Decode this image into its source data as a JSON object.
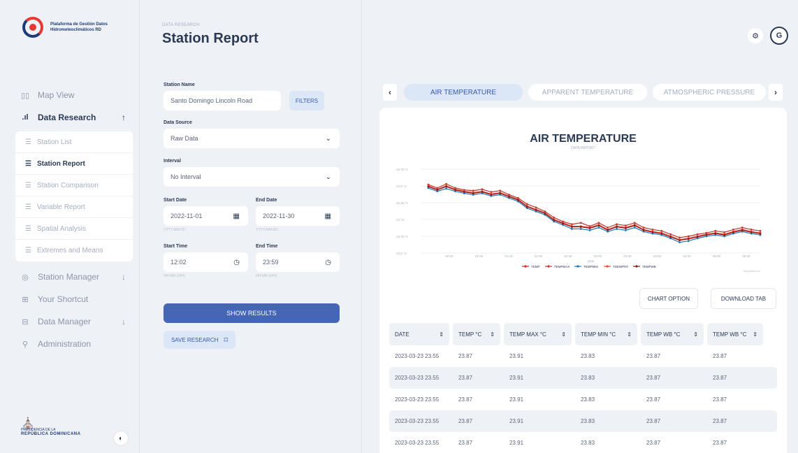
{
  "brand": {
    "line1": "Plataforma de Gestión Datos",
    "line2": "Hidrometeoclimáticos RD",
    "footer_line1": "PRESIDENCIA DE LA",
    "footer_line2": "REPÚBLICA DOMINICANA"
  },
  "sidebar": {
    "items": [
      {
        "label": "Map View",
        "icon": "map-icon"
      },
      {
        "label": "Data Research",
        "icon": "bar-chart-icon",
        "arrow": "↑"
      },
      {
        "label": "Station Manager",
        "icon": "location-pin-icon",
        "arrow": "↓"
      },
      {
        "label": "Your Shortcut",
        "icon": "grid-icon"
      },
      {
        "label": "Data Manager",
        "icon": "database-icon",
        "arrow": "↓"
      },
      {
        "label": "Administration",
        "icon": "wrench-icon"
      }
    ],
    "subitems": [
      {
        "label": "Station List"
      },
      {
        "label": "Station Report"
      },
      {
        "label": "Station Comparison"
      },
      {
        "label": "Variable Report"
      },
      {
        "label": "Spatial Analysis"
      },
      {
        "label": "Extremes and Means"
      }
    ]
  },
  "header": {
    "breadcrumb": "DATA RESEARCH",
    "title": "Station Report"
  },
  "form": {
    "station_name_label": "Station Name",
    "station_name_value": "Santo Domingo Lincoln Road",
    "filters_label": "FILTERS",
    "data_source_label": "Data Source",
    "data_source_value": "Raw Data",
    "interval_label": "Interval",
    "interval_value": "No Interval",
    "start_date_label": "Start Date",
    "start_date_value": "2022-11-01",
    "start_date_hint": "YYYY-MM-DD",
    "end_date_label": "End Date",
    "end_date_value": "2022-11-30",
    "end_date_hint": "YYYY-MM-DD",
    "start_time_label": "Start Time",
    "start_time_value": "12:02",
    "start_time_hint": "HH:MM (24H)",
    "end_time_label": "End Time",
    "end_time_value": "23:59",
    "end_time_hint": "HH:MM (24H)",
    "show_results_label": "SHOW RESULTS",
    "save_research_label": "SAVE RESEARCH"
  },
  "tabs": [
    {
      "label": "AIR TEMPERATURE",
      "active": true
    },
    {
      "label": "APPARENT TEMPERATURE",
      "active": false
    },
    {
      "label": "ATMOSPHERIC PRESSURE",
      "active": false
    }
  ],
  "chart_option_label": "CHART OPTION",
  "download_label": "DOWNLOAD TAB",
  "chart_data": {
    "type": "line",
    "title": "AIR TEMPERATURE",
    "subtitle": "DATA REPORT",
    "xlabel": "Date",
    "ylabel": "",
    "yticks": [
      "24.75 °C",
      "24.5 °C",
      "24.25 °C",
      "24 °C",
      "23.75 °C",
      "23.5 °C"
    ],
    "ylim": [
      23.5,
      24.75
    ],
    "xticks": [
      "00:30",
      "01:00",
      "01:30",
      "02:00",
      "02:30",
      "03:00",
      "03:30",
      "04:00",
      "04:30",
      "05:00",
      "05:30"
    ],
    "credit": "Highcharts.com",
    "series": [
      {
        "name": "TEMP",
        "color": "#d62728",
        "values": [
          24.5,
          24.45,
          24.5,
          24.45,
          24.42,
          24.4,
          24.42,
          24.38,
          24.4,
          24.35,
          24.3,
          24.2,
          24.15,
          24.1,
          24.0,
          23.95,
          23.9,
          23.9,
          23.88,
          23.92,
          23.85,
          23.9,
          23.88,
          23.92,
          23.85,
          23.82,
          23.8,
          23.75,
          23.7,
          23.72,
          23.75,
          23.78,
          23.8,
          23.78,
          23.82,
          23.85,
          23.82,
          23.8
        ]
      },
      {
        "name": "TEMPMAX",
        "color": "#c0392b",
        "values": [
          24.52,
          24.47,
          24.53,
          24.47,
          24.44,
          24.43,
          24.45,
          24.41,
          24.43,
          24.37,
          24.32,
          24.23,
          24.18,
          24.12,
          24.03,
          23.97,
          23.93,
          23.95,
          23.9,
          23.95,
          23.88,
          23.93,
          23.91,
          23.95,
          23.88,
          23.85,
          23.83,
          23.78,
          23.73,
          23.75,
          23.78,
          23.8,
          23.83,
          23.81,
          23.85,
          23.88,
          23.85,
          23.83
        ]
      },
      {
        "name": "TEMPMIN",
        "color": "#1f77b4",
        "values": [
          24.47,
          24.42,
          24.46,
          24.42,
          24.39,
          24.37,
          24.39,
          24.35,
          24.37,
          24.32,
          24.27,
          24.17,
          24.12,
          24.07,
          23.97,
          23.92,
          23.86,
          23.86,
          23.84,
          23.88,
          23.82,
          23.86,
          23.84,
          23.88,
          23.82,
          23.79,
          23.77,
          23.72,
          23.66,
          23.68,
          23.72,
          23.75,
          23.77,
          23.75,
          23.79,
          23.82,
          23.79,
          23.77
        ]
      },
      {
        "name": "TDEWPNT",
        "color": "#e74c3c",
        "values": [
          24.5,
          24.45,
          24.5,
          24.45,
          24.42,
          24.4,
          24.42,
          24.38,
          24.4,
          24.35,
          24.3,
          24.2,
          24.15,
          24.1,
          24.0,
          23.95,
          23.9,
          23.9,
          23.88,
          23.92,
          23.85,
          23.9,
          23.88,
          23.92,
          23.85,
          23.82,
          23.8,
          23.75,
          23.7,
          23.72,
          23.75,
          23.78,
          23.8,
          23.78,
          23.82,
          23.85,
          23.82,
          23.8
        ]
      },
      {
        "name": "TEMPWB",
        "color": "#8b1a1a",
        "values": [
          24.49,
          24.44,
          24.49,
          24.44,
          24.41,
          24.39,
          24.41,
          24.37,
          24.39,
          24.34,
          24.29,
          24.19,
          24.14,
          24.09,
          23.99,
          23.94,
          23.89,
          23.89,
          23.87,
          23.91,
          23.84,
          23.89,
          23.87,
          23.91,
          23.84,
          23.81,
          23.79,
          23.74,
          23.69,
          23.71,
          23.74,
          23.77,
          23.79,
          23.77,
          23.81,
          23.84,
          23.81,
          23.79
        ]
      }
    ]
  },
  "table": {
    "columns": [
      "DATE",
      "TEMP °C",
      "TEMP MAX °C",
      "TEMP MIN °C",
      "TEMP WB °C",
      "TEMP WB °C"
    ],
    "rows": [
      [
        "2023-03-23 23.55",
        "23.87",
        "23.91",
        "23.83",
        "23.87",
        "23.87"
      ],
      [
        "2023-03-23 23.55",
        "23.87",
        "23.91",
        "23.83",
        "23.87",
        "23.87"
      ],
      [
        "2023-03-23 23.55",
        "23.87",
        "23.91",
        "23.83",
        "23.87",
        "23.87"
      ],
      [
        "2023-03-23 23.55",
        "23.87",
        "23.91",
        "23.83",
        "23.87",
        "23.87"
      ],
      [
        "2023-03-23 23.55",
        "23.87",
        "23.91",
        "23.83",
        "23.87",
        "23.87"
      ]
    ]
  }
}
